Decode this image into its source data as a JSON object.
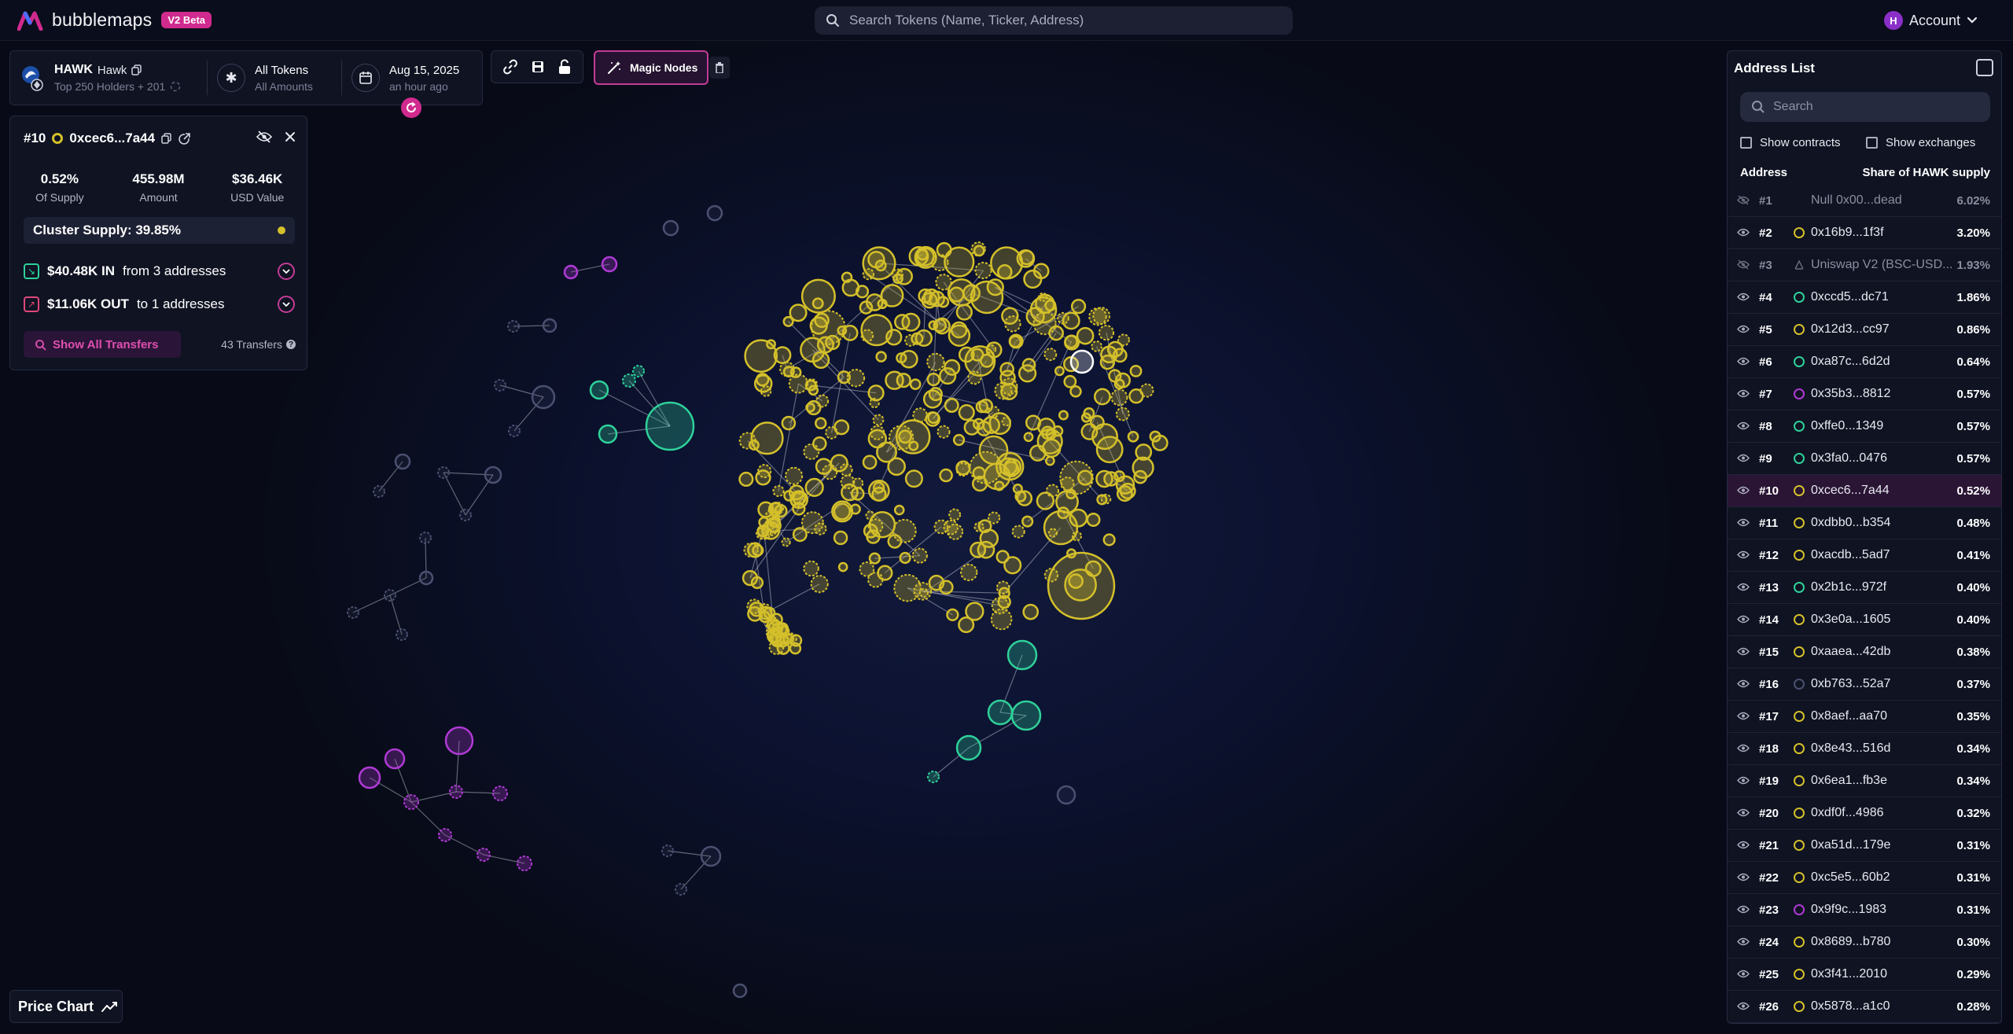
{
  "topbar": {
    "logo_text": "bubblemaps",
    "badge": "V2 Beta",
    "search_placeholder": "Search Tokens (Name, Ticker, Address)",
    "account_initial": "H",
    "account_label": "Account"
  },
  "token": {
    "ticker": "HAWK",
    "name": "Hawk",
    "holders_summary": "Top 250 Holders + 201",
    "filter_title": "All Tokens",
    "filter_sub": "All Amounts",
    "date": "Aug 15, 2025",
    "date_relative": "an hour ago"
  },
  "toolbar": {
    "magic_nodes_label": "Magic Nodes"
  },
  "address_detail": {
    "rank": "#10",
    "address": "0xcec6...7a44",
    "stats": [
      {
        "value": "0.52%",
        "label": "Of Supply"
      },
      {
        "value": "455.98M",
        "label": "Amount"
      },
      {
        "value": "$36.46K",
        "label": "USD Value"
      }
    ],
    "cluster_supply": "Cluster Supply: 39.85%",
    "in_amount": "$40.48K IN",
    "in_text": "from 3 addresses",
    "out_amount": "$11.06K OUT",
    "out_text": "to 1 addresses",
    "show_transfers": "Show All Transfers",
    "transfer_count": "43 Transfers"
  },
  "price_chart_label": "Price Chart",
  "address_list": {
    "title": "Address List",
    "search_placeholder": "Search",
    "show_contracts": "Show contracts",
    "show_exchanges": "Show exchanges",
    "col_address": "Address",
    "col_share": "Share of HAWK supply",
    "rows": [
      {
        "rank": "#1",
        "address": "Null 0x00...dead",
        "share": "6.02%",
        "color": "",
        "dim": true
      },
      {
        "rank": "#2",
        "address": "0x16b9...1f3f",
        "share": "3.20%",
        "color": "#d4c02a",
        "dim": false
      },
      {
        "rank": "#3",
        "address": "Uniswap V2 (BSC-USD...",
        "share": "1.93%",
        "color": "",
        "dim": true
      },
      {
        "rank": "#4",
        "address": "0xccd5...dc71",
        "share": "1.86%",
        "color": "#2fd19a",
        "dim": false
      },
      {
        "rank": "#5",
        "address": "0x12d3...cc97",
        "share": "0.86%",
        "color": "#d4c02a",
        "dim": false
      },
      {
        "rank": "#6",
        "address": "0xa87c...6d2d",
        "share": "0.64%",
        "color": "#2fd19a",
        "dim": false
      },
      {
        "rank": "#7",
        "address": "0x35b3...8812",
        "share": "0.57%",
        "color": "#b03ad6",
        "dim": false
      },
      {
        "rank": "#8",
        "address": "0xffe0...1349",
        "share": "0.57%",
        "color": "#2fd19a",
        "dim": false
      },
      {
        "rank": "#9",
        "address": "0x3fa0...0476",
        "share": "0.57%",
        "color": "#2fd19a",
        "dim": false
      },
      {
        "rank": "#10",
        "address": "0xcec6...7a44",
        "share": "0.52%",
        "color": "#d4c02a",
        "dim": false
      },
      {
        "rank": "#11",
        "address": "0xdbb0...b354",
        "share": "0.48%",
        "color": "#d4c02a",
        "dim": false
      },
      {
        "rank": "#12",
        "address": "0xacdb...5ad7",
        "share": "0.41%",
        "color": "#d4c02a",
        "dim": false
      },
      {
        "rank": "#13",
        "address": "0x2b1c...972f",
        "share": "0.40%",
        "color": "#2fd19a",
        "dim": false
      },
      {
        "rank": "#14",
        "address": "0x3e0a...1605",
        "share": "0.40%",
        "color": "#d4c02a",
        "dim": false
      },
      {
        "rank": "#15",
        "address": "0xaaea...42db",
        "share": "0.38%",
        "color": "#d4c02a",
        "dim": false
      },
      {
        "rank": "#16",
        "address": "0xb763...52a7",
        "share": "0.37%",
        "color": "#4b5070",
        "dim": false
      },
      {
        "rank": "#17",
        "address": "0x8aef...aa70",
        "share": "0.35%",
        "color": "#d4c02a",
        "dim": false
      },
      {
        "rank": "#18",
        "address": "0x8e43...516d",
        "share": "0.34%",
        "color": "#d4c02a",
        "dim": false
      },
      {
        "rank": "#19",
        "address": "0x6ea1...fb3e",
        "share": "0.34%",
        "color": "#d4c02a",
        "dim": false
      },
      {
        "rank": "#20",
        "address": "0xdf0f...4986",
        "share": "0.32%",
        "color": "#d4c02a",
        "dim": false
      },
      {
        "rank": "#21",
        "address": "0xa51d...179e",
        "share": "0.31%",
        "color": "#d4c02a",
        "dim": false
      },
      {
        "rank": "#22",
        "address": "0xc5e5...60b2",
        "share": "0.31%",
        "color": "#d4c02a",
        "dim": false
      },
      {
        "rank": "#23",
        "address": "0x9f9c...1983",
        "share": "0.31%",
        "color": "#b03ad6",
        "dim": false
      },
      {
        "rank": "#24",
        "address": "0x8689...b780",
        "share": "0.30%",
        "color": "#d4c02a",
        "dim": false
      },
      {
        "rank": "#25",
        "address": "0x3f41...2010",
        "share": "0.29%",
        "color": "#d4c02a",
        "dim": false
      },
      {
        "rank": "#26",
        "address": "0x5878...a1c0",
        "share": "0.28%",
        "color": "#d4c02a",
        "dim": false
      }
    ]
  },
  "colors": {
    "accent": "#d12a8f",
    "yellow_cluster": "#d4c02a",
    "green_cluster": "#2fd19a",
    "purple_cluster": "#b03ad6",
    "grey_node": "#4b5070"
  }
}
